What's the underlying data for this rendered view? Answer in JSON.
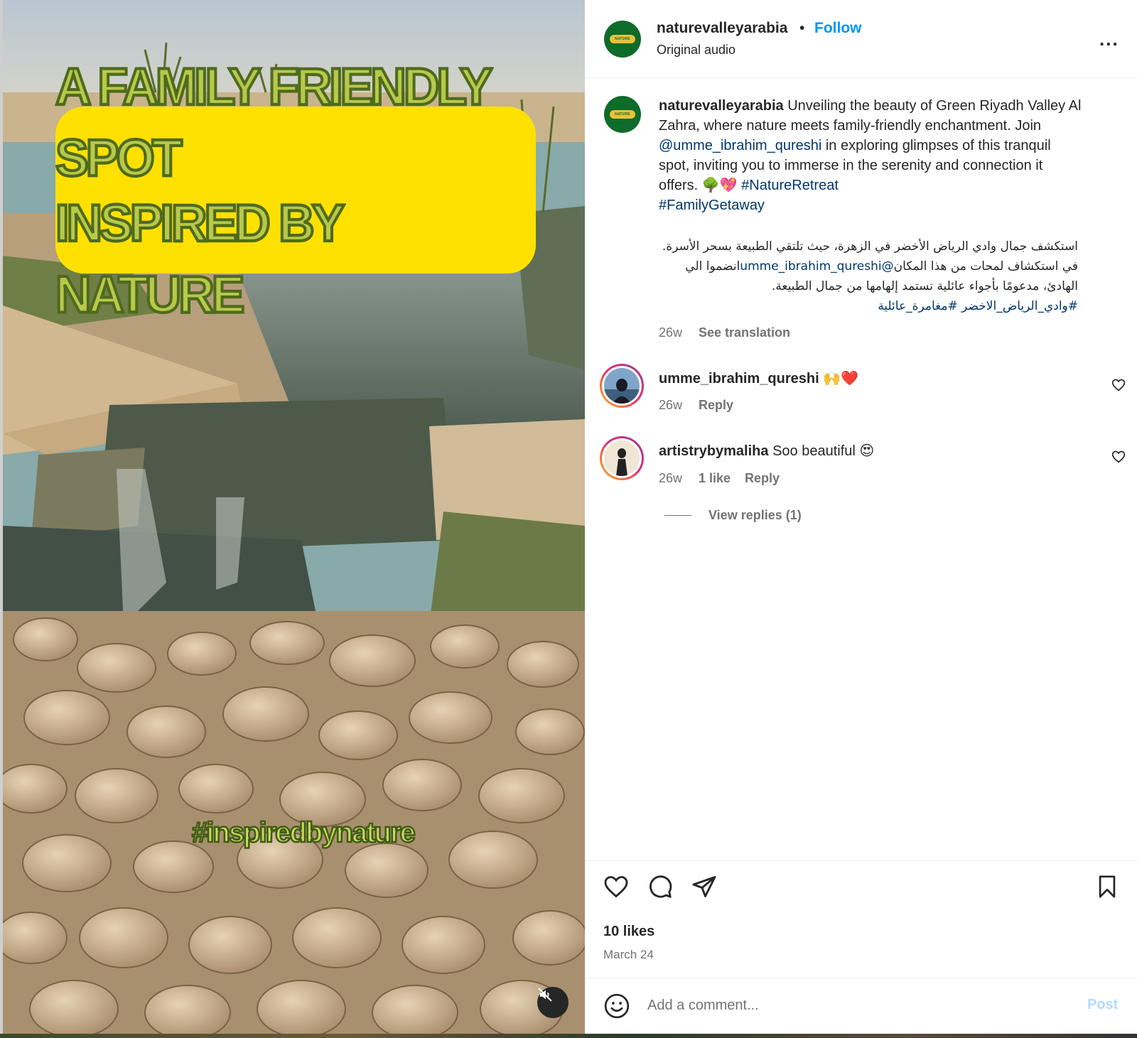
{
  "media": {
    "overlay_line1": "A FAMILY FRIENDLY SPOT",
    "overlay_line2": "INSPIRED BY NATURE",
    "overlay_hashtag": "#inspiredbynature",
    "mute_icon": "speaker-muted-icon"
  },
  "header": {
    "username": "naturevalleyarabia",
    "separator": "•",
    "follow_label": "Follow",
    "audio_label": "Original audio",
    "more_label": "...",
    "avatar_badge": "NATURE VALLEY"
  },
  "caption": {
    "username": "naturevalleyarabia",
    "text_1": " Unveiling the beauty of Green Riyadh Valley Al Zahra, where nature meets family-friendly enchantment. Join ",
    "mention": "@umme_ibrahim_qureshi",
    "text_2": " in exploring glimpses of this tranquil spot, inviting you to immerse in the serenity and connection it offers. 🌳💖 ",
    "tag_1": "#NatureRetreat",
    "tag_2": "#FamilyGetaway",
    "arabic_line1": "استكشف جمال وادي الرياض الأخضر في الزهرة، حيث تلتقي الطبيعة بسحر الأسرة.",
    "arabic_line2_a": "انضموا الي ",
    "arabic_mention": "@umme_ibrahim_qureshi",
    "arabic_line2_b": " في استكشاف لمحات من هذا المكان",
    "arabic_line3": "الهادئ، مدعومًا بأجواء عائلية تستمد إلهامها من جمال الطبيعة.",
    "arabic_tags": "#وادي_الرياض_الاخضر #مغامرة_عائلية",
    "time": "26w",
    "see_translation": "See translation"
  },
  "comments": [
    {
      "username": "umme_ibrahim_qureshi",
      "text": " 🙌❤️",
      "time": "26w",
      "likes": "",
      "reply_label": "Reply"
    },
    {
      "username": "artistrybymaliha",
      "text": " Soo beautiful 😍",
      "time": "26w",
      "likes": "1 like",
      "reply_label": "Reply",
      "view_replies": "View replies (1)"
    }
  ],
  "actions": {
    "like_icon": "heart-icon",
    "comment_icon": "comment-icon",
    "share_icon": "send-icon",
    "save_icon": "bookmark-icon",
    "likes_count": "10 likes",
    "date": "March 24"
  },
  "comment_bar": {
    "emoji_icon": "smiley-icon",
    "placeholder": "Add a comment...",
    "post_label": "Post"
  },
  "colors": {
    "accent": "#0095f6",
    "link": "#00376b",
    "overlay_bg": "#ffe100",
    "overlay_text": "#b8c94a"
  }
}
